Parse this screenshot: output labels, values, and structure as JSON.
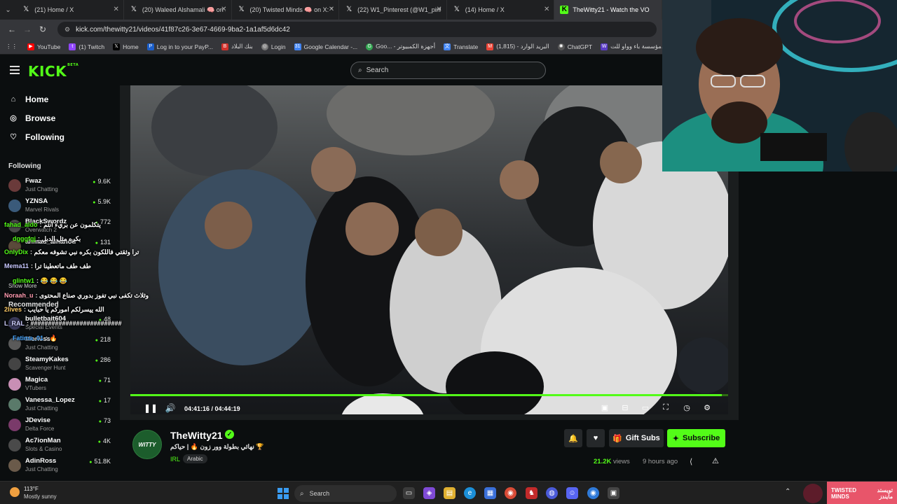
{
  "browser": {
    "tabs": [
      {
        "title": "(21) Home / X",
        "icon": "x-icon"
      },
      {
        "title": "(20) Waleed Alshamali 🧠 on X: \"",
        "icon": "x-icon"
      },
      {
        "title": "(20) Twisted Minds 🧠 on X: \"",
        "icon": "x-icon"
      },
      {
        "title": "(22) W1_Pinterest (@W1_pinte",
        "icon": "x-icon"
      },
      {
        "title": "(14) Home / X",
        "icon": "x-icon"
      },
      {
        "title": "TheWitty21 - Watch the VO",
        "icon": "kick-icon"
      }
    ],
    "url": "kick.com/thewitty21/videos/41f87c26-3e67-4669-9ba2-1a1af5d6dc42",
    "bookmarks": [
      {
        "label": "YouTube",
        "color": "#ff0000"
      },
      {
        "label": "(1) Twitch",
        "color": "#9146ff"
      },
      {
        "label": "Home",
        "color": "#000000"
      },
      {
        "label": "Log in to your PayP...",
        "color": "#1b5fcb"
      },
      {
        "label": "بنك البلاد",
        "color": "#d2312b"
      },
      {
        "label": "Login",
        "color": "#777777"
      },
      {
        "label": "Google Calendar -...",
        "color": "#4285f4"
      },
      {
        "label": "Goo... - أجهزة الكمبيوتر",
        "color": "#34a853"
      },
      {
        "label": "Translate",
        "color": "#4285f4"
      },
      {
        "label": "(1,815) - البريد الوارد",
        "color": "#ea4335"
      },
      {
        "label": "ChatGPT",
        "color": "#555555"
      },
      {
        "label": "مؤسسة باء وواو للت...",
        "color": "#5a3cc4"
      }
    ]
  },
  "kick": {
    "search_placeholder": "Search",
    "logo": "KICK",
    "logo_badge": "BETA",
    "nav": [
      {
        "label": "Home",
        "icon": "home-icon"
      },
      {
        "label": "Browse",
        "icon": "compass-icon"
      },
      {
        "label": "Following",
        "icon": "heart-icon"
      }
    ],
    "following_heading": "Following",
    "following": [
      {
        "name": "Fwaz",
        "category": "Just Chatting",
        "viewers": "9.6K",
        "color": "#6a3a3a"
      },
      {
        "name": "YZNSA",
        "category": "Marvel Rivals",
        "viewers": "5.9K",
        "color": "#3a5a7a"
      },
      {
        "name": "BlackSwordz",
        "category": "Overwatch 2",
        "viewers": "772",
        "color": "#4a4a4a"
      },
      {
        "name": "ahmad_alhanoti",
        "category": "",
        "viewers": "131",
        "color": "#5a4a3a"
      }
    ],
    "show_more": "Show More",
    "recommended_heading": "Recommended",
    "recommended": [
      {
        "name": "bulletbait604",
        "category": "Special Events",
        "viewers": "48",
        "color": "#3a3a5a"
      },
      {
        "name": "Moriess",
        "category": "Just Chatting",
        "viewers": "218",
        "color": "#5a5a5a"
      },
      {
        "name": "SteamyKakes",
        "category": "Scavenger Hunt",
        "viewers": "286",
        "color": "#444444"
      },
      {
        "name": "Magica",
        "category": "VTubers",
        "viewers": "71",
        "color": "#c98fb5"
      },
      {
        "name": "Vanessa_Lopez",
        "category": "Just Chatting",
        "viewers": "17",
        "color": "#5a7a6a"
      },
      {
        "name": "JDevise",
        "category": "Delta Force",
        "viewers": "73",
        "color": "#7a3a6a"
      },
      {
        "name": "Ac7ionMan",
        "category": "Slots & Casino",
        "viewers": "4K",
        "color": "#4a4a4a"
      },
      {
        "name": "AdinRoss",
        "category": "Just Chatting",
        "viewers": "51.8K",
        "color": "#6a5a4a"
      }
    ]
  },
  "chat_overlay": [
    {
      "user": "fahad_aldo",
      "text": "يتكلمون عن بريء انتم",
      "color": "#53fc18"
    },
    {
      "user": "dgggfgj",
      "text": "بكره مثل الدبل",
      "color": "#53fc18"
    },
    {
      "user": "OnlyDix",
      "text": "ترا وثقتي فاللكون بكره نبي تشوفه معكم",
      "color": "#53fc18"
    },
    {
      "user": "Mema11",
      "text": "طف طف ماتعطينا ترا",
      "color": "#c8c8ff"
    },
    {
      "user": "glintw1",
      "text": "😂 😂 😂",
      "color": "#53fc18"
    },
    {
      "user": "Noraah_u",
      "text": "وثلاث تكفى نبي تفوز بدوري صناع المحتوى",
      "color": "#ff9bb0"
    },
    {
      "user": "2lives",
      "text": "الله ييسرلكم اموركم يا حبايب",
      "color": "#ffcc66"
    },
    {
      "user": "L_RAL",
      "text": "##########################",
      "color": "#d0d0ff"
    },
    {
      "user": "Fatima_01",
      "text": "🔥",
      "color": "#4aa8ff"
    }
  ],
  "player": {
    "current_time": "04:41:16",
    "duration": "04:44:19",
    "progress": 0.989,
    "control_icons": [
      "pause-icon",
      "volume-icon",
      "pip-icon",
      "theater-icon",
      "cinema-icon",
      "fullscreen-icon",
      "speed-icon",
      "settings-icon"
    ]
  },
  "stream": {
    "channel": "TheWitty21",
    "avatar_text": "WITTY",
    "title": "نهائي بطولة وور زون 🔥 | حياكم 🏆",
    "category": "IRL",
    "tag": "Arabic",
    "follow_icon": "bell-icon",
    "heart_icon": "heart-icon",
    "gift_label": "Gift Subs",
    "subscribe_label": "Subscribe",
    "views": "21.2K",
    "views_label": "views",
    "time_ago": "9 hours ago"
  },
  "taskbar": {
    "temperature": "113°F",
    "weather": "Mostly sunny",
    "search_placeholder": "Search",
    "brand_text_en": "TWISTED MINDS",
    "brand_text_ar": "تويستد مايندز"
  }
}
